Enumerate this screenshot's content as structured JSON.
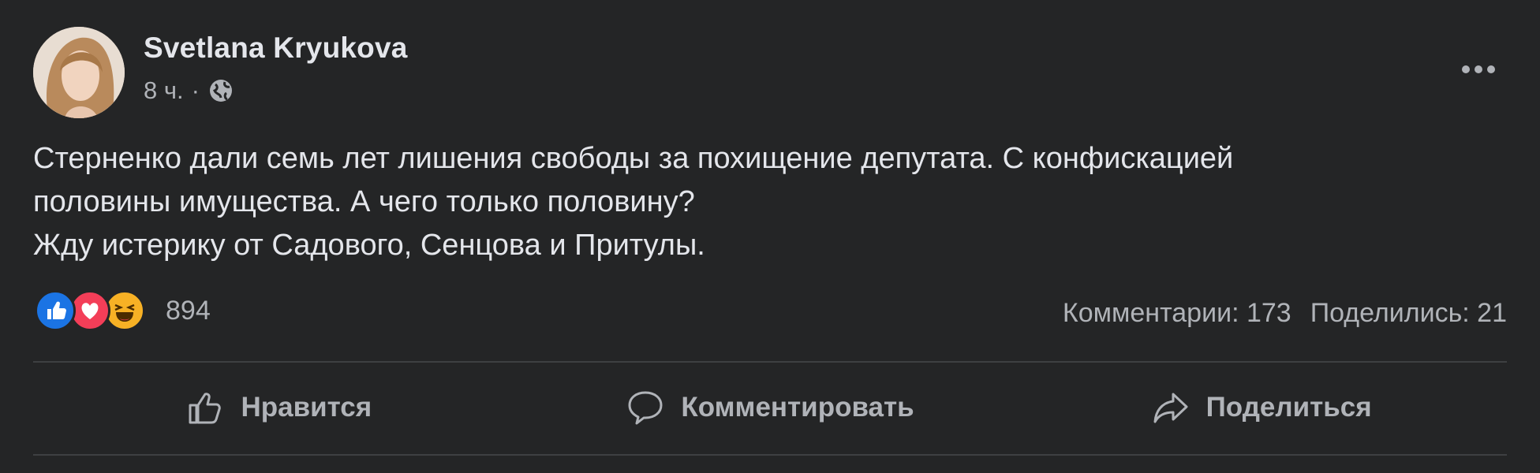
{
  "post": {
    "author": "Svetlana Kryukova",
    "time": "8 ч.",
    "separator": "·",
    "privacy_icon": "globe-icon",
    "text_lines": [
      "Стерненко дали семь лет лишения свободы за похищение депутата. С конфискацией",
      "половины имущества. А чего только половину?",
      "Жду истерику от Садового, Сенцова и Притулы."
    ]
  },
  "reactions": {
    "icons": [
      "like-icon",
      "love-icon",
      "haha-icon"
    ],
    "count": "894"
  },
  "stats": {
    "comments": "Комментарии: 173",
    "shares": "Поделились: 21"
  },
  "actions": {
    "like": "Нравится",
    "comment": "Комментировать",
    "share": "Поделиться"
  },
  "colors": {
    "background": "#242526",
    "text_primary": "#e4e6eb",
    "text_secondary": "#b0b3b8",
    "like_blue": "#1b74e4",
    "love_red": "#f33e58",
    "haha_yellow": "#f7b125"
  }
}
